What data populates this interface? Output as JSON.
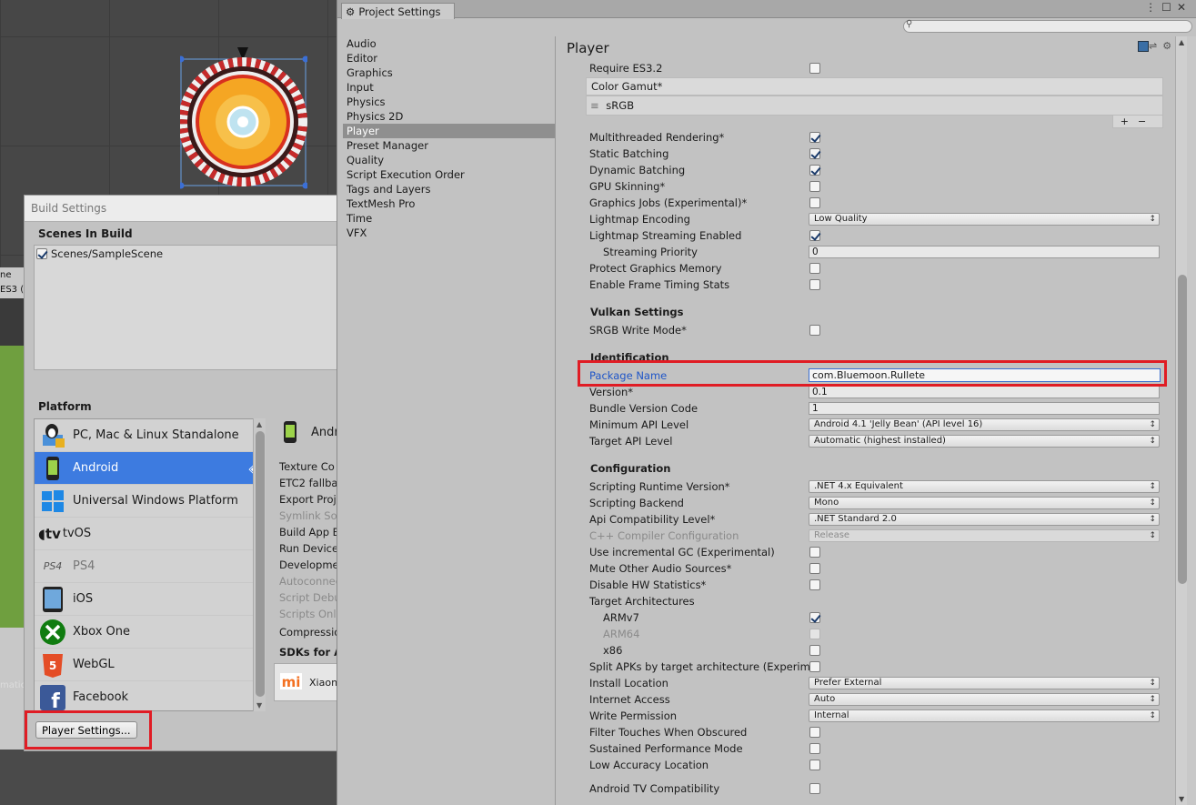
{
  "left_strip": {
    "text1": "ne",
    "text2": "ES3 (2",
    "text3": "matic"
  },
  "build_settings": {
    "title": "Build Settings",
    "scenes_header": "Scenes In Build",
    "scenes": [
      {
        "name": "Scenes/SampleScene",
        "checked": true
      }
    ],
    "platform_header": "Platform",
    "platforms": [
      {
        "label": "PC, Mac & Linux Standalone",
        "icon": "pc-mac-linux-icon"
      },
      {
        "label": "Android",
        "icon": "android-icon",
        "selected": true
      },
      {
        "label": "Universal Windows Platform",
        "icon": "windows-icon"
      },
      {
        "label": "tvOS",
        "icon": "appletv-icon"
      },
      {
        "label": "PS4",
        "icon": "ps4-icon",
        "disabled": true
      },
      {
        "label": "iOS",
        "icon": "ios-icon"
      },
      {
        "label": "Xbox One",
        "icon": "xbox-icon"
      },
      {
        "label": "WebGL",
        "icon": "html5-icon"
      },
      {
        "label": "Facebook",
        "icon": "facebook-icon"
      }
    ],
    "android_panel": {
      "title": "Andr",
      "rows": [
        "Texture Co",
        "ETC2 fallba",
        "Export Proj",
        "Symlink So",
        "Build App B",
        "Run Device",
        "Developme",
        "Autoconnec",
        "Script Debu",
        "Scripts Only",
        "Compressio"
      ],
      "sdks_header": "SDKs for A",
      "sdk_item": "Xiaon"
    },
    "player_settings_button": "Player Settings..."
  },
  "project_settings": {
    "tab_title": "Project Settings",
    "nav": [
      "Audio",
      "Editor",
      "Graphics",
      "Input",
      "Physics",
      "Physics 2D",
      "Player",
      "Preset Manager",
      "Quality",
      "Script Execution Order",
      "Tags and Layers",
      "TextMesh Pro",
      "Time",
      "VFX"
    ],
    "selected_nav": "Player",
    "section_title": "Player",
    "require_es32": "Require ES3.2",
    "color_gamut_label": "Color Gamut*",
    "color_gamut_value": "sRGB",
    "rendering": [
      {
        "label": "Multithreaded Rendering*",
        "checked": true
      },
      {
        "label": "Static Batching",
        "checked": true
      },
      {
        "label": "Dynamic Batching",
        "checked": true
      },
      {
        "label": "GPU Skinning*",
        "checked": false
      },
      {
        "label": "Graphics Jobs (Experimental)*",
        "checked": false
      }
    ],
    "lightmap_encoding_label": "Lightmap Encoding",
    "lightmap_encoding_value": "Low Quality",
    "lightmap_streaming_label": "Lightmap Streaming Enabled",
    "streaming_priority_label": "Streaming Priority",
    "streaming_priority_value": "0",
    "protect_graphics_label": "Protect Graphics Memory",
    "frame_timing_label": "Enable Frame Timing Stats",
    "vulkan_header": "Vulkan Settings",
    "srgb_write_label": "SRGB Write Mode*",
    "identification_header": "Identification",
    "package_name_label": "Package Name",
    "package_name_value": "com.Bluemoon.Rullete",
    "version_label": "Version*",
    "version_value": "0.1",
    "bundle_code_label": "Bundle Version Code",
    "bundle_code_value": "1",
    "min_api_label": "Minimum API Level",
    "min_api_value": "Android 4.1 'Jelly Bean' (API level 16)",
    "target_api_label": "Target API Level",
    "target_api_value": "Automatic (highest installed)",
    "configuration_header": "Configuration",
    "scripting_runtime_label": "Scripting Runtime Version*",
    "scripting_runtime_value": ".NET 4.x Equivalent",
    "scripting_backend_label": "Scripting Backend",
    "scripting_backend_value": "Mono",
    "api_compat_label": "Api Compatibility Level*",
    "api_compat_value": ".NET Standard 2.0",
    "cpp_config_label": "C++ Compiler Configuration",
    "cpp_config_value": "Release",
    "incremental_gc_label": "Use incremental GC (Experimental)",
    "mute_audio_label": "Mute Other Audio Sources*",
    "disable_hw_label": "Disable HW Statistics*",
    "target_arch_label": "Target Architectures",
    "armv7_label": "ARMv7",
    "arm64_label": "ARM64",
    "x86_label": "x86",
    "split_apks_label": "Split APKs by target architecture (Experim",
    "install_location_label": "Install Location",
    "install_location_value": "Prefer External",
    "internet_access_label": "Internet Access",
    "internet_access_value": "Auto",
    "write_permission_label": "Write Permission",
    "write_permission_value": "Internal",
    "filter_touches_label": "Filter Touches When Obscured",
    "sustained_perf_label": "Sustained Performance Mode",
    "low_accuracy_label": "Low Accuracy Location",
    "android_tv_label": "Android TV Compatibility"
  },
  "colors": {
    "highlight_red": "#e01c24",
    "selection_blue": "#3d7be0",
    "link_blue": "#1e55c8"
  }
}
